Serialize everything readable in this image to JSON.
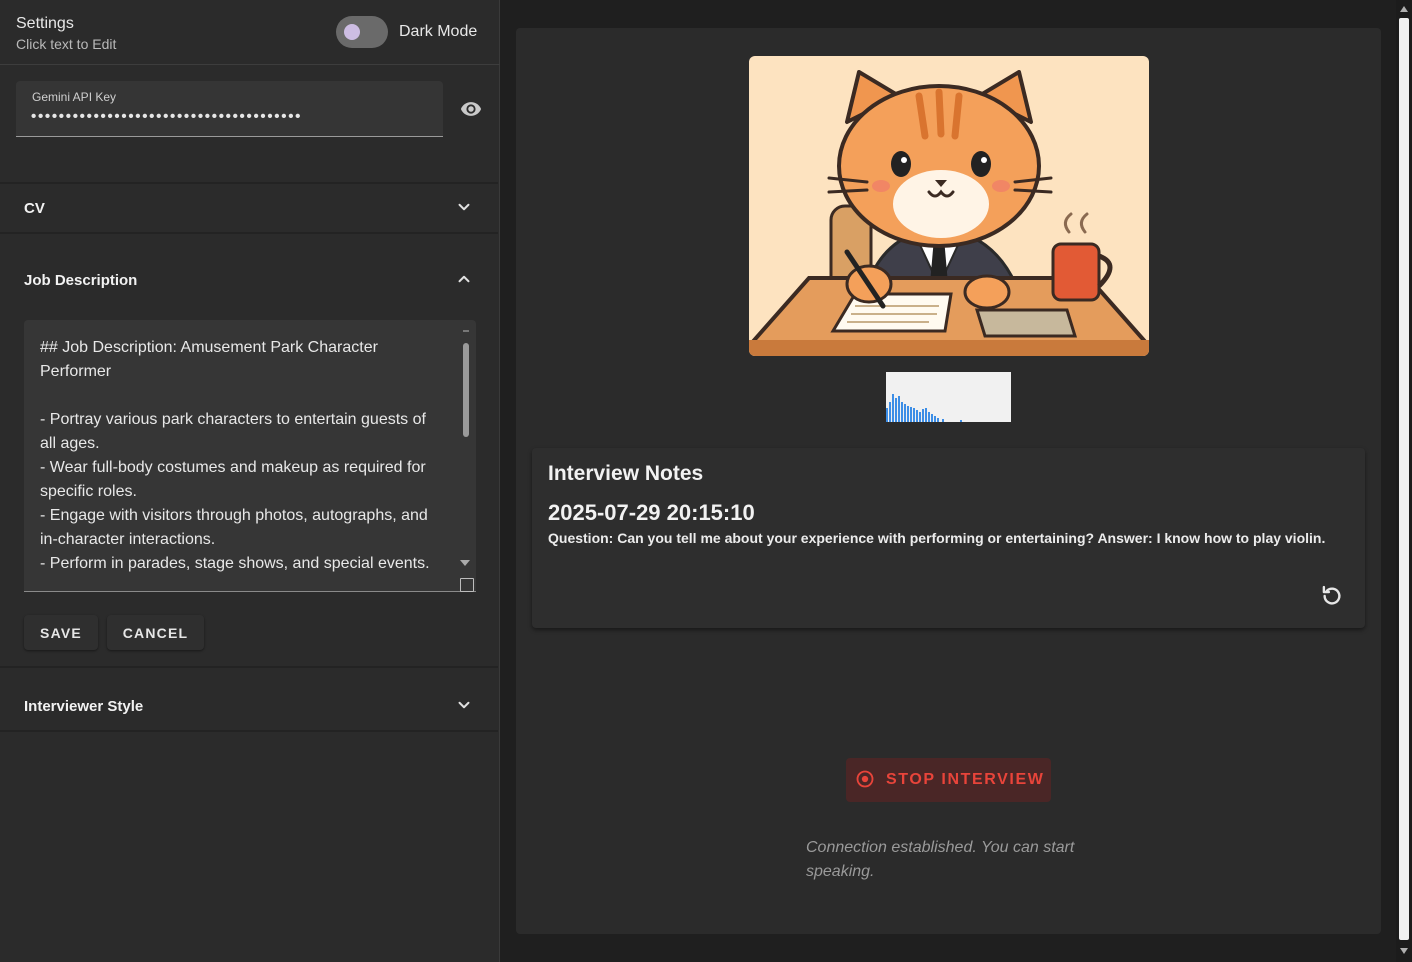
{
  "settings": {
    "title": "Settings",
    "subtitle": "Click text to Edit",
    "dark_mode_label": "Dark Mode"
  },
  "api_key": {
    "label": "Gemini API Key",
    "masked_value": "•••••••••••••••••••••••••••••••••••••••"
  },
  "accordions": {
    "cv": "CV",
    "job_description": "Job Description",
    "interviewer_style": "Interviewer Style"
  },
  "job_description": {
    "text": "## Job Description: Amusement Park Character Performer\n\n- Portray various park characters to entertain guests of all ages.\n- Wear full-body costumes and makeup as required for specific roles.\n- Engage with visitors through photos, autographs, and in-character interactions.\n- Perform in parades, stage shows, and special events."
  },
  "buttons": {
    "save": "SAVE",
    "cancel": "CANCEL",
    "stop_interview": "STOP INTERVIEW"
  },
  "notes": {
    "title": "Interview Notes",
    "timestamp": "2025-07-29 20:15:10",
    "entry": "Question: Can you tell me about your experience with performing or entertaining? Answer: I know how to play violin."
  },
  "status": "Connection established. You can start speaking.",
  "colors": {
    "accent_stop": "#e8443a",
    "toggle_thumb": "#cdbde3"
  }
}
